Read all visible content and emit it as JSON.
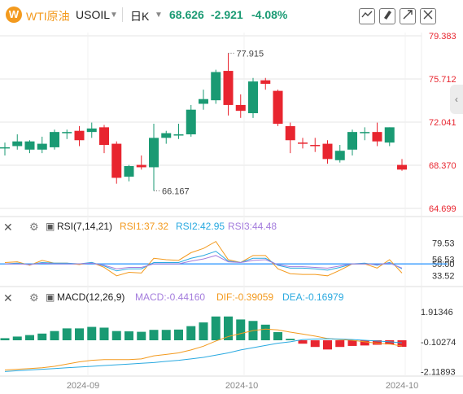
{
  "header": {
    "logo": "W",
    "symbol_name": "WTI原油",
    "symbol_code": "USOIL",
    "period": "日K",
    "price": "68.626",
    "change": "-2.921",
    "change_pct": "-4.08%",
    "tools": [
      "draw-icon",
      "paint-icon",
      "expand-icon",
      "collapse-icon"
    ]
  },
  "sidebar_toggle": "‹",
  "colors": {
    "up": "#1a9a73",
    "down": "#e8252f",
    "axis_red": "#e8252f",
    "grid": "#e6e6e6",
    "rsi1": "#f39a1e",
    "rsi2": "#29a9e0",
    "rsi3": "#a47ddd",
    "macd": "#a47ddd",
    "dif": "#f39a1e",
    "dea": "#29a9e0",
    "hline": "#3399ff"
  },
  "rsi_header": {
    "name": "RSI(7,14,21)",
    "rsi1": "RSI1:37.32",
    "rsi2": "RSI2:42.95",
    "rsi3": "RSI3:44.48"
  },
  "macd_header": {
    "name": "MACD(12,26,9)",
    "macd": "MACD:-0.44160",
    "dif": "DIF:-0.39059",
    "dea": "DEA:-0.16979"
  },
  "chart_data": [
    {
      "type": "candlestick",
      "title": "WTI原油 USOIL 日K",
      "y_ticks": [
        "79.383",
        "75.712",
        "72.041",
        "68.370",
        "64.699"
      ],
      "ylim": [
        64.699,
        79.383
      ],
      "x_ticks": [
        "2024-09",
        "2024-10",
        "2024-10"
      ],
      "annotations": [
        "77.915",
        "66.167"
      ],
      "candles": [
        {
          "o": 69.9,
          "h": 70.3,
          "l": 69.2,
          "c": 69.9
        },
        {
          "o": 70.0,
          "h": 71.0,
          "l": 69.7,
          "c": 70.4
        },
        {
          "o": 69.7,
          "h": 70.5,
          "l": 69.4,
          "c": 70.4
        },
        {
          "o": 69.7,
          "h": 70.8,
          "l": 69.4,
          "c": 70.2
        },
        {
          "o": 69.9,
          "h": 71.4,
          "l": 69.7,
          "c": 71.2
        },
        {
          "o": 71.2,
          "h": 71.4,
          "l": 70.6,
          "c": 71.2
        },
        {
          "o": 71.3,
          "h": 71.7,
          "l": 70.0,
          "c": 70.5
        },
        {
          "o": 71.2,
          "h": 72.0,
          "l": 70.7,
          "c": 71.5
        },
        {
          "o": 71.6,
          "h": 71.8,
          "l": 69.4,
          "c": 70.1
        },
        {
          "o": 70.2,
          "h": 70.4,
          "l": 66.8,
          "c": 67.3
        },
        {
          "o": 67.4,
          "h": 68.4,
          "l": 67.0,
          "c": 68.3
        },
        {
          "o": 68.4,
          "h": 69.2,
          "l": 68.0,
          "c": 68.2
        },
        {
          "o": 68.2,
          "h": 71.9,
          "l": 66.2,
          "c": 70.7
        },
        {
          "o": 70.7,
          "h": 71.3,
          "l": 70.2,
          "c": 71.1
        },
        {
          "o": 70.9,
          "h": 71.9,
          "l": 70.6,
          "c": 71.0
        },
        {
          "o": 71.0,
          "h": 73.5,
          "l": 70.8,
          "c": 73.1
        },
        {
          "o": 73.6,
          "h": 74.8,
          "l": 73.1,
          "c": 74.0
        },
        {
          "o": 73.9,
          "h": 76.5,
          "l": 73.6,
          "c": 76.3
        },
        {
          "o": 76.4,
          "h": 77.9,
          "l": 72.6,
          "c": 73.5
        },
        {
          "o": 73.5,
          "h": 74.4,
          "l": 72.4,
          "c": 73.0
        },
        {
          "o": 72.8,
          "h": 75.8,
          "l": 72.4,
          "c": 75.5
        },
        {
          "o": 75.6,
          "h": 75.8,
          "l": 74.8,
          "c": 75.3
        },
        {
          "o": 74.7,
          "h": 74.8,
          "l": 71.7,
          "c": 71.9
        },
        {
          "o": 71.7,
          "h": 72.0,
          "l": 69.4,
          "c": 70.5
        },
        {
          "o": 70.3,
          "h": 70.7,
          "l": 69.8,
          "c": 70.2
        },
        {
          "o": 70.1,
          "h": 70.7,
          "l": 69.5,
          "c": 70.0
        },
        {
          "o": 70.2,
          "h": 70.5,
          "l": 68.5,
          "c": 68.9
        },
        {
          "o": 68.8,
          "h": 70.1,
          "l": 68.6,
          "c": 69.6
        },
        {
          "o": 69.7,
          "h": 71.4,
          "l": 69.2,
          "c": 71.2
        },
        {
          "o": 71.1,
          "h": 71.6,
          "l": 70.5,
          "c": 71.2
        },
        {
          "o": 71.2,
          "h": 72.0,
          "l": 70.0,
          "c": 70.4
        },
        {
          "o": 70.3,
          "h": 71.6,
          "l": 70.0,
          "c": 71.6
        },
        {
          "o": 68.4,
          "h": 68.9,
          "l": 67.9,
          "c": 68.0
        }
      ]
    },
    {
      "type": "line",
      "title": "RSI(7,14,21)",
      "y_ticks": [
        "79.53",
        "56.53",
        "50.00",
        "33.52"
      ],
      "ylim": [
        20,
        92
      ],
      "hline": 50,
      "series": [
        {
          "name": "RSI1",
          "values": [
            52,
            53,
            48,
            55,
            51,
            51,
            49,
            52,
            45,
            33,
            38,
            37,
            58,
            56,
            55,
            66,
            72,
            82,
            56,
            52,
            62,
            62,
            43,
            36,
            35,
            35,
            33,
            41,
            50,
            50,
            44,
            56,
            37
          ]
        },
        {
          "name": "RSI2",
          "values": [
            50,
            51,
            49,
            52,
            51,
            51,
            50,
            52,
            47,
            40,
            43,
            43,
            52,
            52,
            52,
            58,
            62,
            68,
            54,
            52,
            58,
            58,
            48,
            44,
            44,
            43,
            41,
            45,
            50,
            51,
            48,
            52,
            43
          ]
        },
        {
          "name": "RSI3",
          "values": [
            50,
            50,
            49,
            51,
            50,
            50,
            50,
            51,
            48,
            43,
            45,
            45,
            50,
            50,
            50,
            54,
            57,
            62,
            53,
            52,
            55,
            56,
            49,
            46,
            46,
            45,
            44,
            47,
            50,
            50,
            49,
            51,
            44
          ]
        }
      ]
    },
    {
      "type": "bar",
      "title": "MACD(12,26,9)",
      "y_ticks": [
        "1.91346",
        "-0.10274",
        "-2.11893"
      ],
      "ylim": [
        -2.3,
        2.3
      ],
      "series": [
        {
          "name": "MACD",
          "values": [
            0.14,
            0.25,
            0.35,
            0.45,
            0.62,
            0.8,
            0.8,
            0.9,
            0.85,
            0.62,
            0.6,
            0.57,
            0.7,
            0.7,
            0.72,
            0.95,
            1.2,
            1.6,
            1.6,
            1.4,
            1.3,
            1.05,
            0.55,
            0.1,
            -0.23,
            -0.45,
            -0.62,
            -0.45,
            -0.38,
            -0.35,
            -0.3,
            -0.28,
            -0.44
          ]
        },
        {
          "name": "DIF",
          "values": [
            -2.0,
            -1.95,
            -1.9,
            -1.85,
            -1.75,
            -1.6,
            -1.45,
            -1.35,
            -1.3,
            -1.3,
            -1.3,
            -1.25,
            -1.05,
            -0.95,
            -0.85,
            -0.65,
            -0.4,
            -0.05,
            0.25,
            0.45,
            0.65,
            0.75,
            0.7,
            0.55,
            0.42,
            0.28,
            0.12,
            0.05,
            0.0,
            -0.1,
            -0.2,
            -0.25,
            -0.39
          ]
        },
        {
          "name": "DEA",
          "values": [
            -2.1,
            -2.05,
            -2.0,
            -1.95,
            -1.9,
            -1.85,
            -1.8,
            -1.75,
            -1.7,
            -1.65,
            -1.6,
            -1.55,
            -1.5,
            -1.42,
            -1.35,
            -1.25,
            -1.15,
            -1.0,
            -0.85,
            -0.65,
            -0.5,
            -0.35,
            -0.2,
            -0.1,
            0.05,
            0.08,
            0.1,
            0.08,
            0.05,
            0.0,
            -0.05,
            -0.1,
            -0.17
          ]
        }
      ]
    }
  ]
}
